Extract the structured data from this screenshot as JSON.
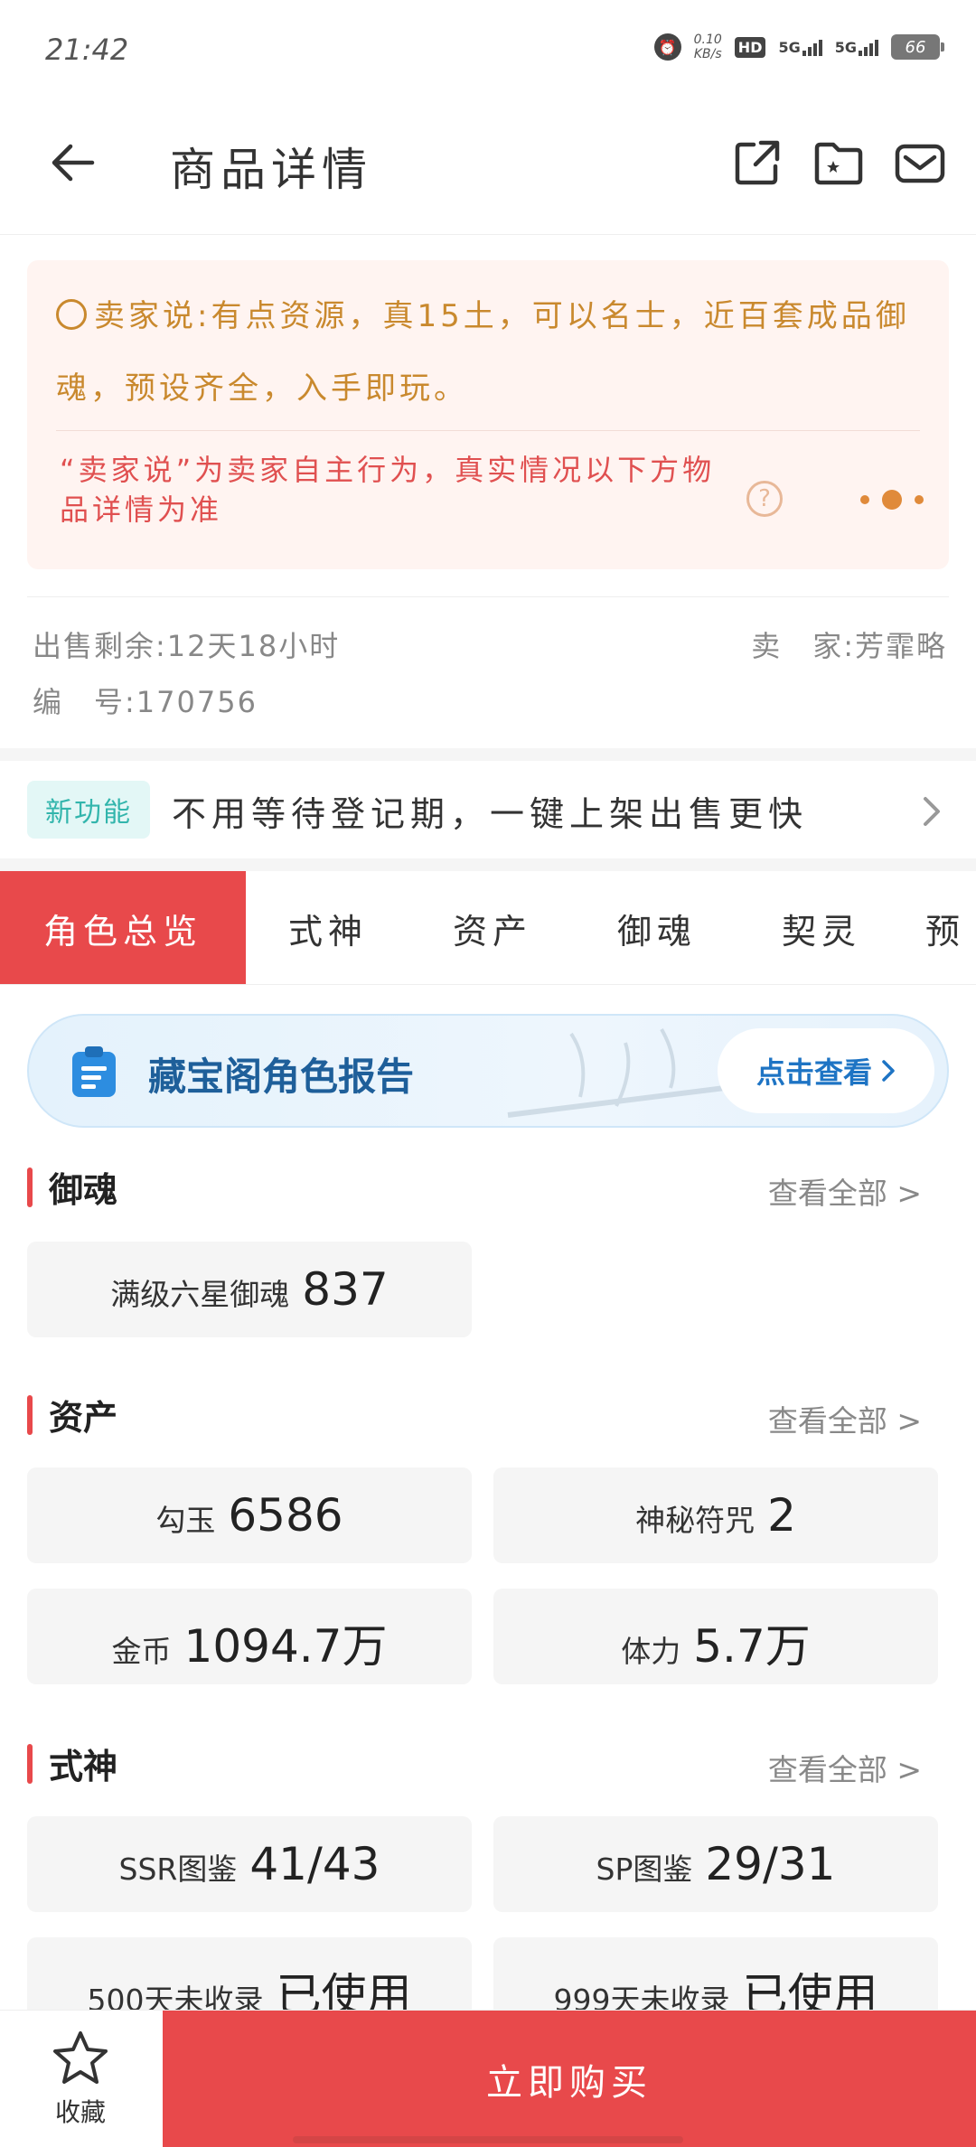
{
  "status_bar": {
    "time": "21:42",
    "net_speed_value": "0.10",
    "net_speed_unit": "KB/s",
    "hd_label": "HD",
    "sim1_label": "5G",
    "sim2_label": "5G",
    "battery": "66"
  },
  "header": {
    "title": "商品详情"
  },
  "seller_note": {
    "text": "卖家说:有点资源，真15土，可以名士，近百套成品御魂，预设齐全，入手即玩。",
    "disclaimer": "“卖家说”为卖家自主行为，真实情况以下方物品详情为准",
    "help_symbol": "?"
  },
  "info": {
    "remaining": "出售剩余:12天18小时",
    "seller": "卖　家:芳霏略",
    "serial": "编　号:170756"
  },
  "feature": {
    "tag": "新功能",
    "text": "不用等待登记期，一键上架出售更快"
  },
  "tabs": [
    {
      "label": "角色总览",
      "active": true
    },
    {
      "label": "式神",
      "active": false
    },
    {
      "label": "资产",
      "active": false
    },
    {
      "label": "御魂",
      "active": false
    },
    {
      "label": "契灵",
      "active": false
    },
    {
      "label": "预",
      "active": false
    }
  ],
  "report_banner": {
    "title": "藏宝阁角色报告",
    "button": "点击查看"
  },
  "sections": {
    "yuhun": {
      "title": "御魂",
      "more": "查看全部 >",
      "items": [
        {
          "label": "满级六星御魂",
          "value": "837"
        }
      ]
    },
    "assets": {
      "title": "资产",
      "more": "查看全部 >",
      "items": [
        {
          "label": "勾玉",
          "value": "6586"
        },
        {
          "label": "神秘符咒",
          "value": "2"
        },
        {
          "label": "金币",
          "value": "1094.7万"
        },
        {
          "label": "体力",
          "value": "5.7万"
        }
      ]
    },
    "shikigami": {
      "title": "式神",
      "more": "查看全部 >",
      "items": [
        {
          "label": "SSR图鉴",
          "value": "41/43"
        },
        {
          "label": "SP图鉴",
          "value": "29/31"
        },
        {
          "label": "500天未收录",
          "value": "已使用"
        },
        {
          "label": "999天未收录",
          "value": "已使用"
        }
      ]
    }
  },
  "bottom_bar": {
    "favorite_label": "收藏",
    "buy_label": "立即购买"
  },
  "colors": {
    "accent": "#e8494b",
    "seller_text": "#c9892e",
    "disclaimer": "#e05050",
    "feature_tag": "#32b5ac",
    "report_title": "#1e5f9a"
  }
}
